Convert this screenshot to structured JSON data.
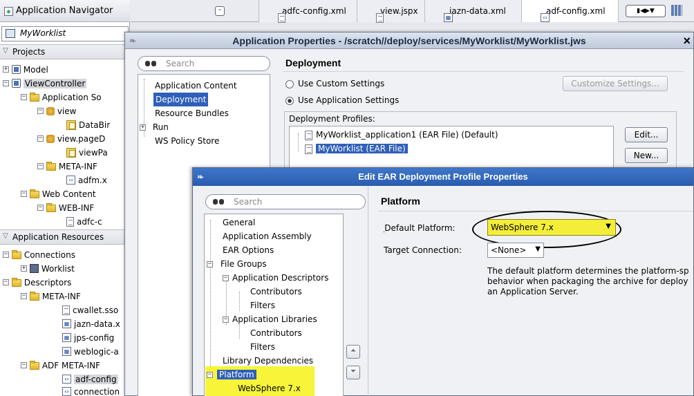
{
  "navigator": {
    "title": "Application Navigator",
    "app_selector": "MyWorklist",
    "projects_label": "Projects",
    "project_items": [
      {
        "label": "Model"
      },
      {
        "label": "ViewController"
      },
      {
        "label": "Application So"
      },
      {
        "label": "view"
      },
      {
        "label": "DataBir"
      },
      {
        "label": "view.pageD"
      },
      {
        "label": "viewPa"
      },
      {
        "label": "META-INF"
      },
      {
        "label": "adfm.x"
      },
      {
        "label": "Web Content"
      },
      {
        "label": "WEB-INF"
      },
      {
        "label": "adfc-c"
      }
    ],
    "app_resources_label": "Application Resources",
    "resource_items": [
      {
        "label": "Connections"
      },
      {
        "label": "Worklist"
      },
      {
        "label": "Descriptors"
      },
      {
        "label": "META-INF"
      },
      {
        "label": "cwallet.sso"
      },
      {
        "label": "jazn-data.x"
      },
      {
        "label": "jps-config"
      },
      {
        "label": "weblogic-a"
      },
      {
        "label": "ADF META-INF"
      },
      {
        "label": "adf-config"
      },
      {
        "label": "connection"
      }
    ]
  },
  "editor_tabs": [
    {
      "label": "adfc-config.xml"
    },
    {
      "label": "view.jspx"
    },
    {
      "label": "jazn-data.xml"
    },
    {
      "label": "adf-config.xml"
    }
  ],
  "app_props": {
    "title": "Application Properties - /scratch//deploy/services/MyWorklist/MyWorklist.jws",
    "close_glyph": "×",
    "search_placeholder": "Search",
    "nav": [
      "Application Content",
      "Deployment",
      "Resource Bundles",
      "Run",
      "WS Policy Store"
    ],
    "heading": "Deployment",
    "use_custom": "Use Custom Settings",
    "use_app": "Use Application Settings",
    "customize_btn": "Customize Settings...",
    "profiles_label": "Deployment Profiles:",
    "profiles": [
      "MyWorklist_application1 (EAR File) (Default)",
      "MyWorklist (EAR File)"
    ],
    "edit_btn": "Edit...",
    "new_btn": "New..."
  },
  "ear_props": {
    "title": "Edit EAR Deployment Profile Properties",
    "search_placeholder": "Search",
    "nav": [
      {
        "label": "General"
      },
      {
        "label": "Application Assembly"
      },
      {
        "label": "EAR Options"
      },
      {
        "label": "File Groups"
      },
      {
        "label": "Application Descriptors"
      },
      {
        "label": "Contributors"
      },
      {
        "label": "Filters"
      },
      {
        "label": "Application Libraries"
      },
      {
        "label": "Contributors"
      },
      {
        "label": "Filters"
      },
      {
        "label": "Library Dependencies"
      },
      {
        "label": "Platform"
      },
      {
        "label": "WebSphere 7.x"
      }
    ],
    "heading": "Platform",
    "default_platform_label": "Default Platform:",
    "default_platform_value": "WebSphere 7.x",
    "target_conn_label": "Target Connection:",
    "target_conn_value": "<None>",
    "description": "The default platform determines the platform-sp\nbehavior when packaging the archive for deploy\nan Application Server.",
    "highlight_color": "#f7f43a",
    "accent_blue": "#2f5fb9"
  }
}
